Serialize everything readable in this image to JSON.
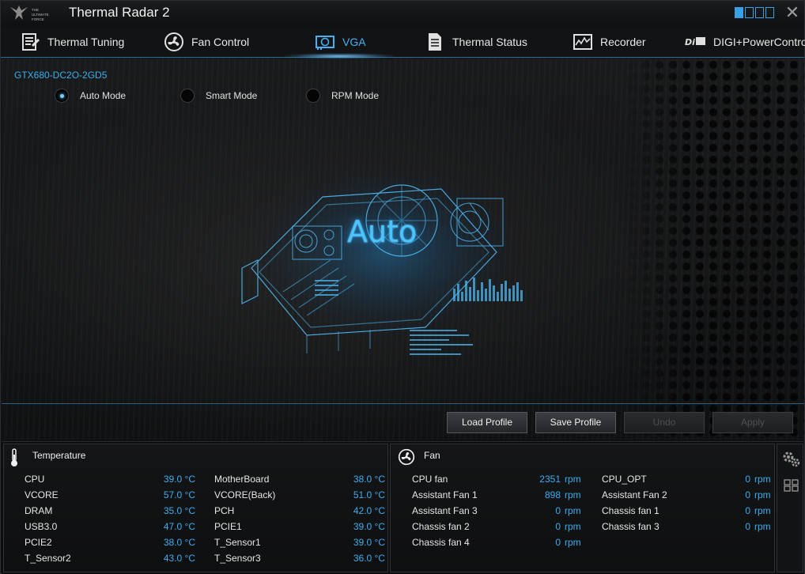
{
  "app": {
    "title": "Thermal Radar 2",
    "logo_text": "THE ULTIMATE FORCE",
    "accent_color": "#3aaef0"
  },
  "tabs": [
    {
      "label": "Thermal Tuning",
      "icon": "thermal-tuning-icon"
    },
    {
      "label": "Fan Control",
      "icon": "fan-icon"
    },
    {
      "label": "VGA",
      "icon": "vga-card-icon",
      "active": true
    },
    {
      "label": "Thermal Status",
      "icon": "document-icon"
    },
    {
      "label": "Recorder",
      "icon": "recorder-chart-icon"
    },
    {
      "label": "DIGI+PowerControl",
      "icon": "digi-power-icon"
    }
  ],
  "main": {
    "device_name": "GTX680-DC2O-2GD5",
    "modes": [
      {
        "label": "Auto Mode",
        "selected": true
      },
      {
        "label": "Smart Mode",
        "selected": false
      },
      {
        "label": "RPM Mode",
        "selected": false
      }
    ],
    "mode_overlay": "Auto",
    "buttons": {
      "load_profile": "Load Profile",
      "save_profile": "Save Profile",
      "undo": "Undo",
      "apply": "Apply"
    }
  },
  "temperature": {
    "title": "Temperature",
    "unit": "°C",
    "left": [
      {
        "label": "CPU",
        "value": "39.0 °C"
      },
      {
        "label": "VCORE",
        "value": "57.0 °C"
      },
      {
        "label": "DRAM",
        "value": "35.0 °C"
      },
      {
        "label": "USB3.0",
        "value": "47.0 °C"
      },
      {
        "label": "PCIE2",
        "value": "38.0 °C"
      },
      {
        "label": "T_Sensor2",
        "value": "43.0 °C"
      }
    ],
    "right": [
      {
        "label": "MotherBoard",
        "value": "38.0 °C"
      },
      {
        "label": "VCORE(Back)",
        "value": "51.0 °C"
      },
      {
        "label": "PCH",
        "value": "42.0 °C"
      },
      {
        "label": "PCIE1",
        "value": "39.0 °C"
      },
      {
        "label": "T_Sensor1",
        "value": "39.0 °C"
      },
      {
        "label": "T_Sensor3",
        "value": "36.0 °C"
      }
    ]
  },
  "fan": {
    "title": "Fan",
    "unit": "rpm",
    "left": [
      {
        "label": "CPU fan",
        "value": "2351"
      },
      {
        "label": "Assistant Fan 1",
        "value": "898"
      },
      {
        "label": "Assistant Fan 3",
        "value": "0"
      },
      {
        "label": "Chassis fan 2",
        "value": "0"
      },
      {
        "label": "Chassis fan 4",
        "value": "0"
      }
    ],
    "right": [
      {
        "label": "CPU_OPT",
        "value": "0"
      },
      {
        "label": "Assistant Fan 2",
        "value": "0"
      },
      {
        "label": "Chassis fan 1",
        "value": "0"
      },
      {
        "label": "Chassis fan 3",
        "value": "0"
      }
    ]
  },
  "side_icons": [
    "settings-gear-icon",
    "grid-view-icon"
  ]
}
